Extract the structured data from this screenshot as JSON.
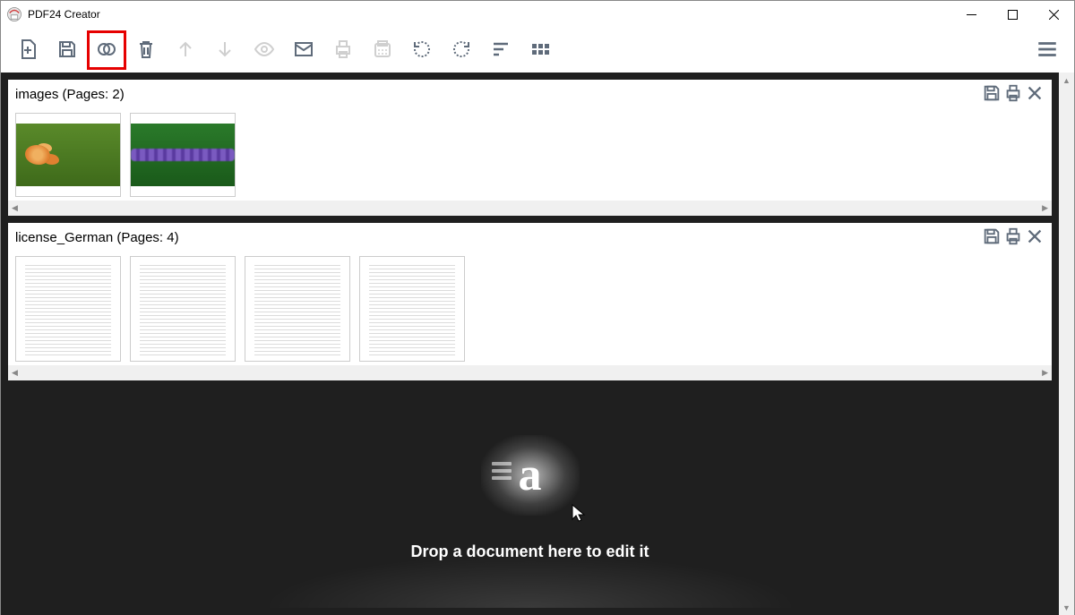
{
  "app": {
    "title": "PDF24 Creator"
  },
  "toolbar": {
    "items": [
      {
        "name": "new-icon",
        "enabled": true
      },
      {
        "name": "save-icon",
        "enabled": true
      },
      {
        "name": "merge-icon",
        "enabled": true,
        "highlighted": true
      },
      {
        "name": "delete-icon",
        "enabled": true
      },
      {
        "name": "arrow-up-icon",
        "enabled": false
      },
      {
        "name": "arrow-down-icon",
        "enabled": false
      },
      {
        "name": "preview-icon",
        "enabled": false
      },
      {
        "name": "mail-icon",
        "enabled": true
      },
      {
        "name": "print-icon",
        "enabled": false
      },
      {
        "name": "fax-icon",
        "enabled": false
      },
      {
        "name": "rotate-left-icon",
        "enabled": true
      },
      {
        "name": "rotate-right-icon",
        "enabled": true
      },
      {
        "name": "sort-icon",
        "enabled": true
      },
      {
        "name": "grid-icon",
        "enabled": true
      }
    ]
  },
  "documents": [
    {
      "title": "images (Pages: 2)",
      "pages": [
        {
          "kind": "image",
          "variant": "a"
        },
        {
          "kind": "image",
          "variant": "b"
        }
      ]
    },
    {
      "title": "license_German (Pages: 4)",
      "pages": [
        {
          "kind": "doc"
        },
        {
          "kind": "doc"
        },
        {
          "kind": "doc"
        },
        {
          "kind": "doc"
        }
      ]
    }
  ],
  "dropzone": {
    "char": "a",
    "text": "Drop a document here to edit it"
  }
}
